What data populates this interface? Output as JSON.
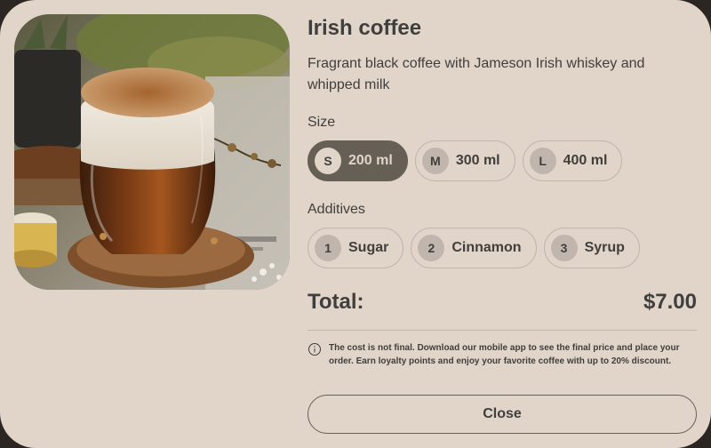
{
  "product": {
    "title": "Irish coffee",
    "description": "Fragrant black coffee with Jameson Irish whiskey and whipped milk"
  },
  "size": {
    "label": "Size",
    "options": [
      {
        "badge": "S",
        "label": "200 ml",
        "selected": true
      },
      {
        "badge": "M",
        "label": "300 ml",
        "selected": false
      },
      {
        "badge": "L",
        "label": "400 ml",
        "selected": false
      }
    ]
  },
  "additives": {
    "label": "Additives",
    "options": [
      {
        "badge": "1",
        "label": "Sugar",
        "selected": false
      },
      {
        "badge": "2",
        "label": "Cinnamon",
        "selected": false
      },
      {
        "badge": "3",
        "label": "Syrup",
        "selected": false
      }
    ]
  },
  "total": {
    "label": "Total:",
    "value": "$7.00"
  },
  "note": {
    "icon": "info-icon",
    "text": "The cost is not final. Download our mobile app to see the final price and place your order. Earn loyalty points and enjoy your favorite coffee with up to 20% discount."
  },
  "close_button": {
    "label": "Close"
  },
  "colors": {
    "background": "#e1d4c9",
    "text": "#403f3d",
    "accent": "#665f55",
    "border": "#c1b6ad"
  }
}
